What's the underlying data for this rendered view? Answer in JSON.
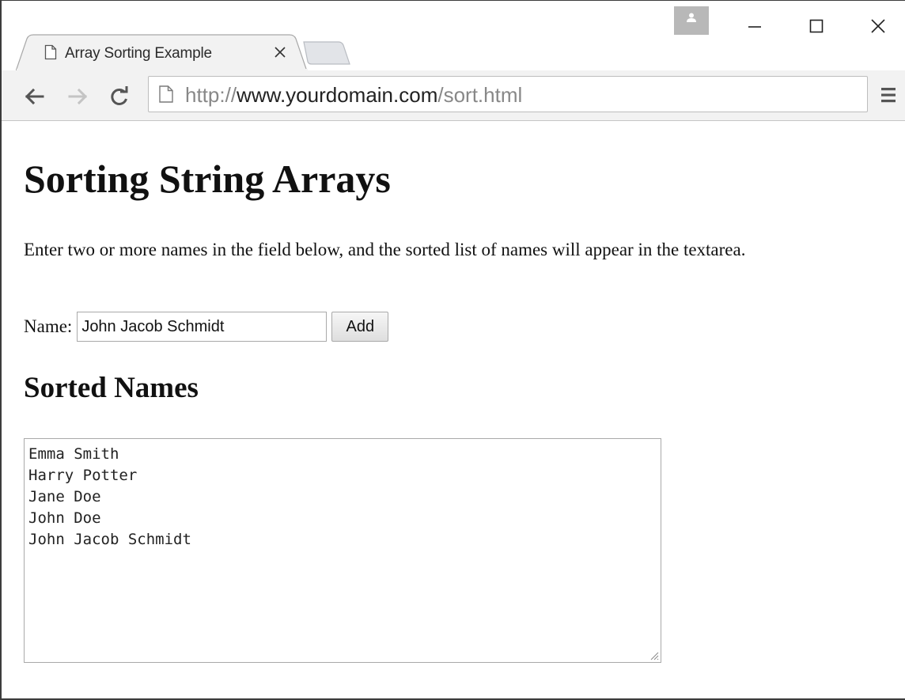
{
  "browser": {
    "tab": {
      "title": "Array Sorting Example"
    },
    "address": {
      "scheme": "http://",
      "host": "www.yourdomain.com",
      "path": "/sort.html"
    },
    "icons": {
      "avatar": "user-avatar-icon",
      "minimize": "minimize-icon",
      "maximize": "maximize-icon",
      "close": "close-icon",
      "back": "back-arrow-icon",
      "forward": "forward-arrow-icon",
      "reload": "reload-icon",
      "page": "page-icon",
      "menu": "hamburger-menu-icon"
    }
  },
  "page": {
    "heading": "Sorting String Arrays",
    "intro": "Enter two or more names in the field below, and the sorted list of names will appear in the textarea.",
    "form": {
      "name_label": "Name:",
      "name_value": "John Jacob Schmidt",
      "add_label": "Add"
    },
    "sorted_heading": "Sorted Names",
    "sorted_names": [
      "Emma Smith",
      "Harry Potter",
      "Jane Doe",
      "John Doe",
      "John Jacob Schmidt"
    ]
  }
}
